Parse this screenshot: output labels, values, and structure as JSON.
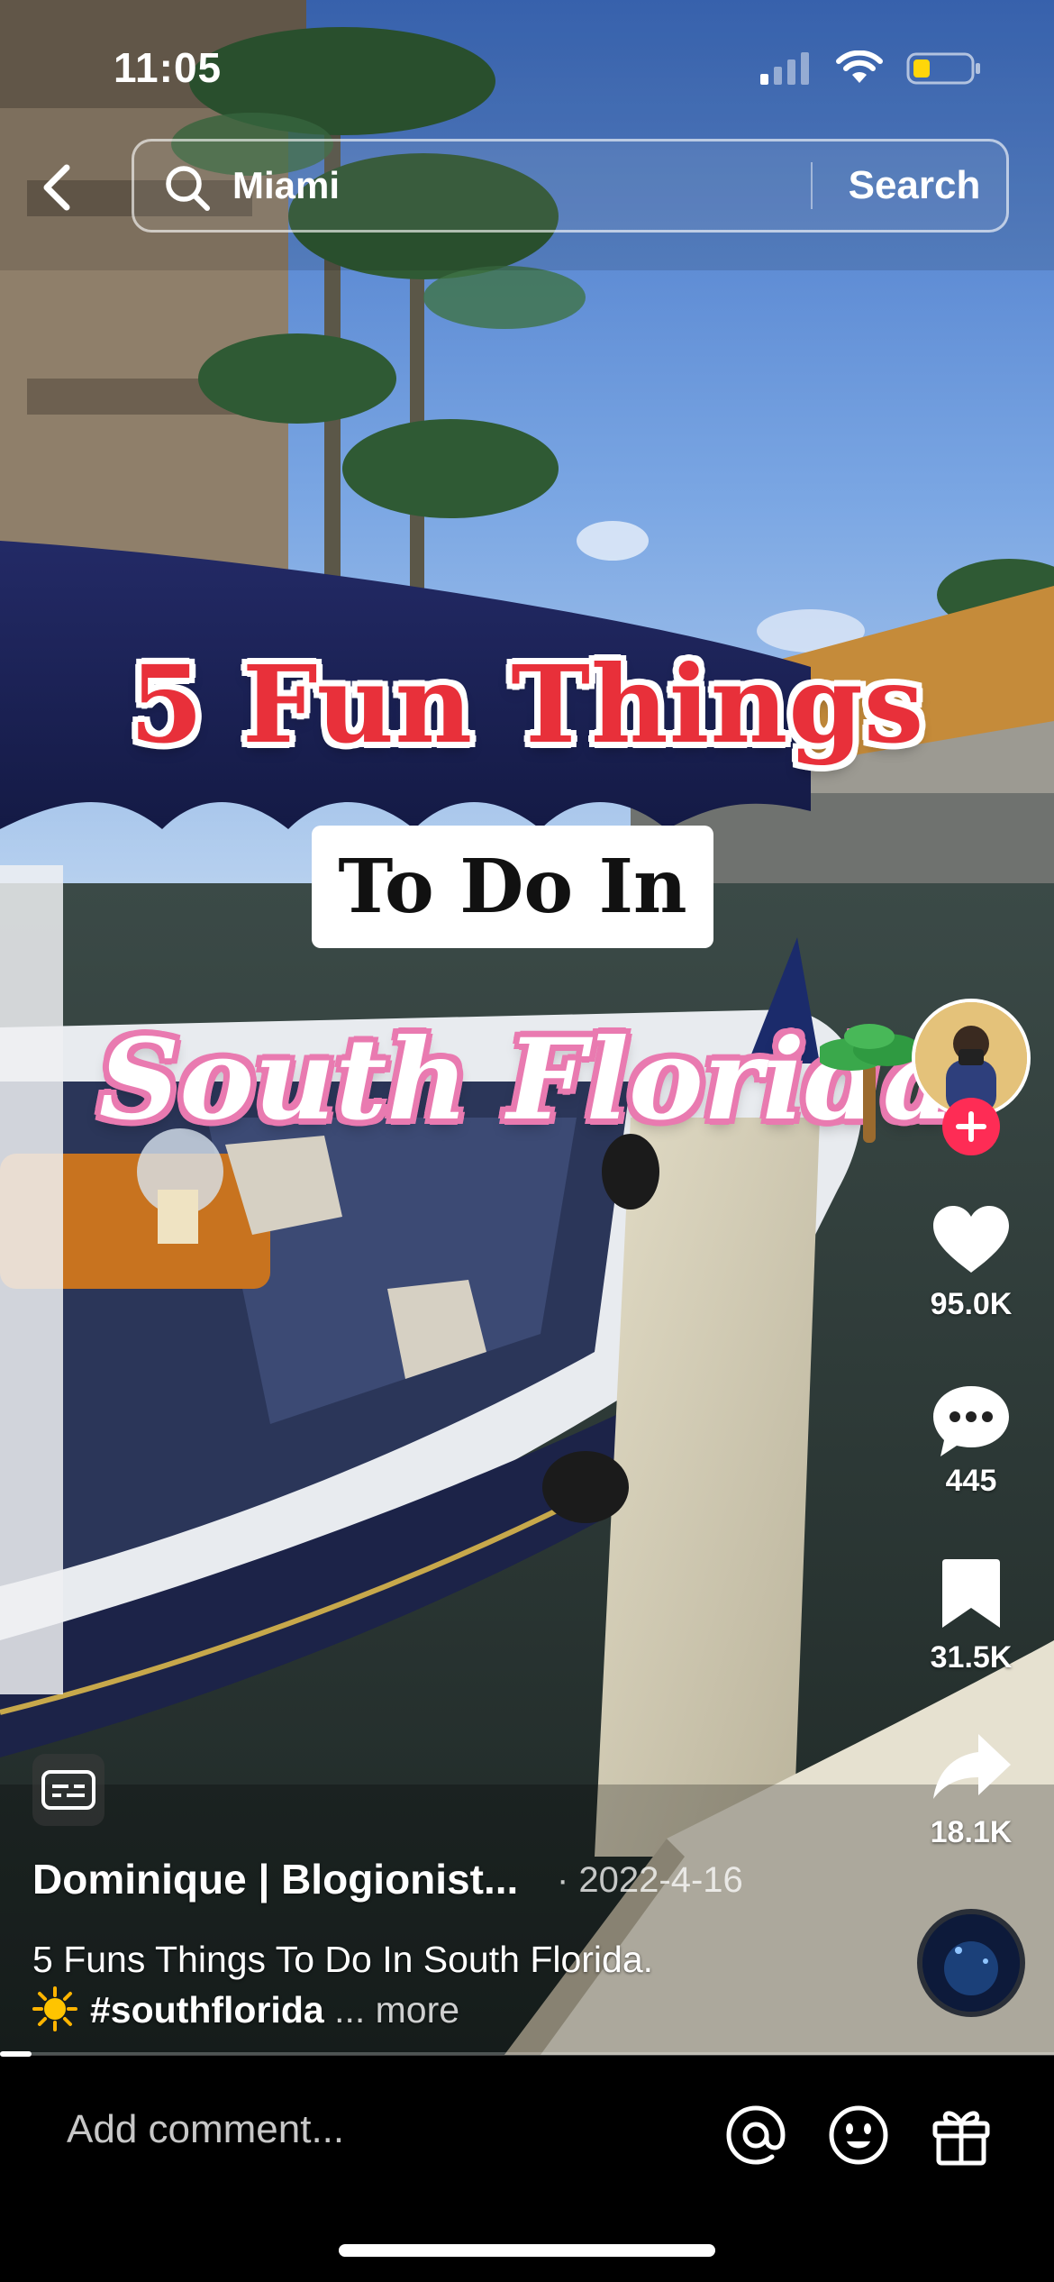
{
  "status_bar": {
    "time": "11:05",
    "battery_color": "#ffd60a"
  },
  "search": {
    "query": "Miami",
    "button_label": "Search"
  },
  "video_text": {
    "line1": "5 Fun Things",
    "line2": "To Do In",
    "line3": "South Florida"
  },
  "actions": {
    "likes": "95.0K",
    "comments": "445",
    "saves": "31.5K",
    "shares": "18.1K"
  },
  "post": {
    "author": "Dominique | Blogionist...",
    "date": "· 2022-4-16",
    "caption_line1": "5 Funs Things To Do In South Florida.",
    "caption_hashtag": "#southflorida",
    "caption_more": "... more",
    "progress_fraction": 0.03
  },
  "comment_bar": {
    "placeholder": "Add comment..."
  },
  "colors": {
    "follow_badge": "#fe2c55",
    "title_red": "#e8303a",
    "title_pink": "#e97ab0"
  }
}
